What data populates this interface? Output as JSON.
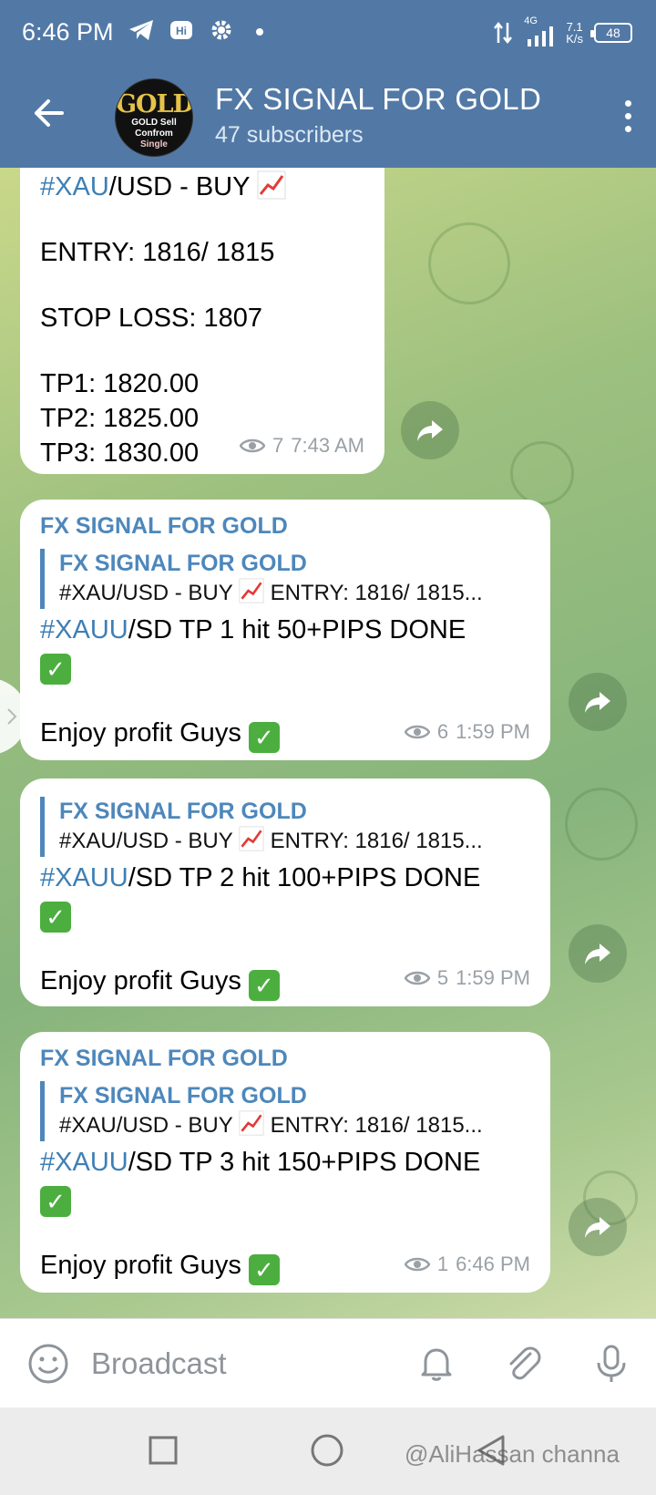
{
  "status_bar": {
    "time": "6:46 PM",
    "network": "4G",
    "speed_value": "7.1",
    "speed_unit": "K/s",
    "battery": "48"
  },
  "header": {
    "title": "FX SIGNAL FOR GOLD",
    "subtitle": "47 subscribers",
    "avatar": {
      "title": "GOLD",
      "line1": "GOLD Sell",
      "line2": "Confrom",
      "line3": "Single"
    }
  },
  "messages": [
    {
      "signal_tag": "#XAU",
      "signal_rest": "/USD - BUY",
      "entry": "ENTRY: 1816/ 1815",
      "stop_loss": "STOP LOSS: 1807",
      "tp1": "TP1: 1820.00",
      "tp2": "TP2: 1825.00",
      "tp3": "TP3: 1830.00",
      "views": "7",
      "time": "7:43 AM"
    },
    {
      "sender": "FX SIGNAL FOR GOLD",
      "reply_name": "FX SIGNAL FOR GOLD",
      "reply_text": "#XAU/USD - BUY",
      "reply_text2": "ENTRY: 1816/ 1815...",
      "tag": "#XAUU",
      "text": "/SD TP 1 hit 50+PIPS DONE",
      "enjoy": "Enjoy profit Guys",
      "views": "6",
      "time": "1:59 PM"
    },
    {
      "reply_name": "FX SIGNAL FOR GOLD",
      "reply_text": "#XAU/USD - BUY",
      "reply_text2": "ENTRY: 1816/ 1815...",
      "tag": "#XAUU",
      "text": "/SD TP 2 hit 100+PIPS DONE",
      "enjoy": "Enjoy profit Guys",
      "views": "5",
      "time": "1:59 PM"
    },
    {
      "sender": "FX SIGNAL FOR GOLD",
      "reply_name": "FX SIGNAL FOR GOLD",
      "reply_text": "#XAU/USD - BUY",
      "reply_text2": "ENTRY: 1816/ 1815...",
      "tag": "#XAUU",
      "text": "/SD TP 3 hit 150+PIPS DONE",
      "enjoy": "Enjoy profit Guys",
      "views": "1",
      "time": "6:46 PM"
    }
  ],
  "input": {
    "placeholder": "Broadcast"
  },
  "watermark": "@AliHassan channa"
}
